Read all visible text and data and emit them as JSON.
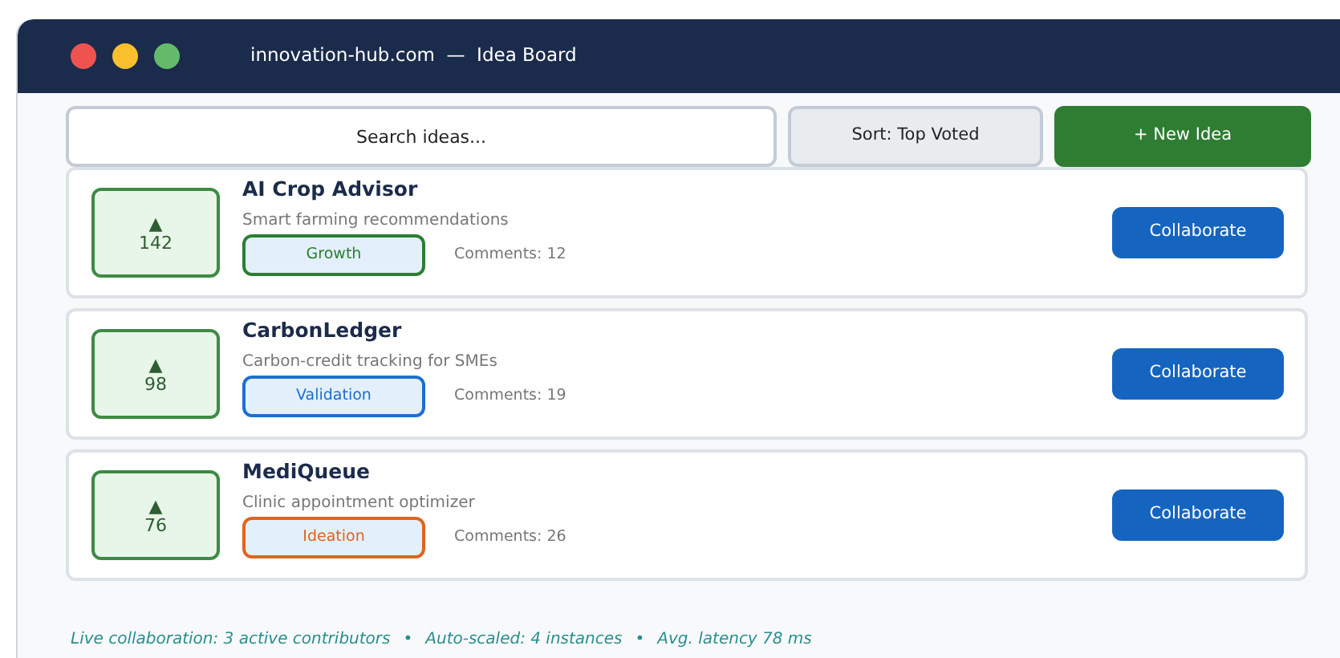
{
  "window": {
    "title": "innovation-hub.com  —  Idea Board"
  },
  "toolbar": {
    "search": {
      "placeholder": "Search ideas..."
    },
    "sort": "Sort: Top Voted",
    "new_button": "+ New Idea"
  },
  "ideas": [
    {
      "votes": "142",
      "vote_icon": "▲",
      "title": "AI Crop Advisor",
      "description": "Smart farming recommendations",
      "stage": "Growth",
      "color": "#2e7d32",
      "comments": "Comments: 12",
      "action": "Collaborate"
    },
    {
      "votes": "98",
      "vote_icon": "▲",
      "title": "CarbonLedger",
      "description": "Carbon-credit tracking for SMEs",
      "stage": "Validation",
      "color": "#1e6fd0",
      "comments": "Comments: 19",
      "action": "Collaborate"
    },
    {
      "votes": "76",
      "vote_icon": "▲",
      "title": "MediQueue",
      "description": "Clinic appointment optimizer",
      "stage": "Ideation",
      "color": "#e0641e",
      "comments": "Comments: 26",
      "action": "Collaborate"
    }
  ],
  "status_bar": {
    "items": [
      "Live collaboration: 3 active contributors",
      "Auto-scaled: 4 instances",
      "Avg. latency 78 ms"
    ],
    "separator": "•"
  }
}
